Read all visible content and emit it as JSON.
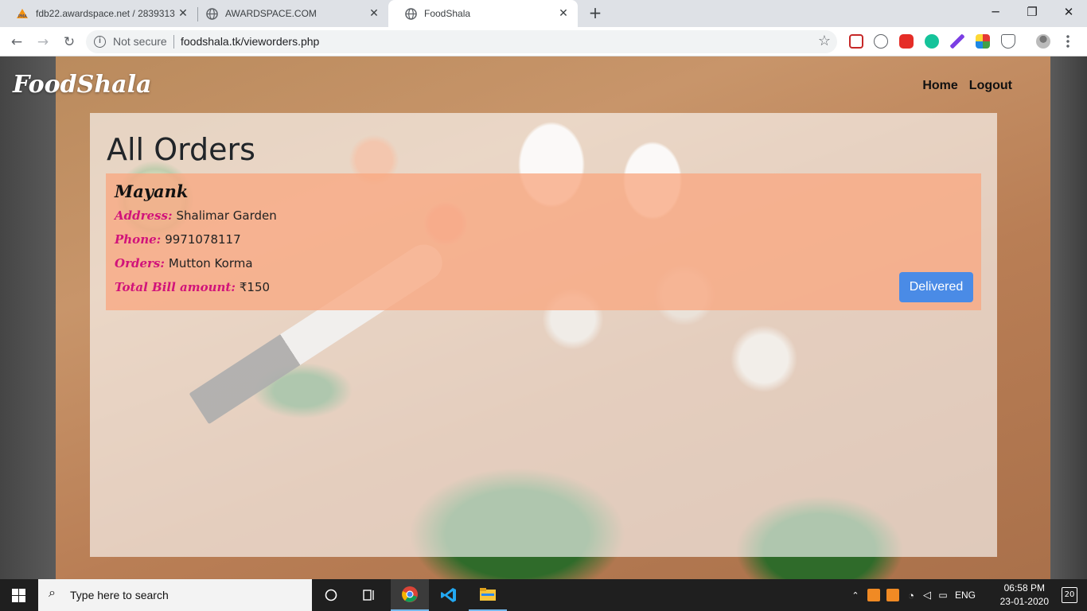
{
  "browser": {
    "tabs": [
      {
        "title": "fdb22.awardspace.net / 2839313",
        "active": false
      },
      {
        "title": "AWARDSPACE.COM",
        "active": false
      },
      {
        "title": "FoodShala",
        "active": true
      }
    ],
    "new_tab_label": "+",
    "window_controls": {
      "minimize": "─",
      "restore": "❐",
      "close": "✕"
    },
    "security_label": "Not secure",
    "url": "foodshala.tk/vieworders.php"
  },
  "site": {
    "brand": "FoodShala",
    "nav": [
      {
        "label": "Home"
      },
      {
        "label": "Logout"
      }
    ]
  },
  "page": {
    "title": "All Orders",
    "orders": [
      {
        "customer": "Mayank",
        "address_label": "Address:",
        "address": "Shalimar Garden",
        "phone_label": "Phone:",
        "phone": "9971078117",
        "orders_label": "Orders:",
        "orders": "Mutton Korma",
        "bill_label": "Total Bill amount:",
        "bill": "₹150",
        "status_button": "Delivered"
      }
    ]
  },
  "taskbar": {
    "search_placeholder": "Type here to search",
    "language": "ENG",
    "time": "06:58 PM",
    "date": "23-01-2020",
    "notification_count": "20"
  },
  "colors": {
    "label_accent": "#d1137a",
    "order_card": "#f9a882",
    "button_blue": "#4a8be6"
  }
}
